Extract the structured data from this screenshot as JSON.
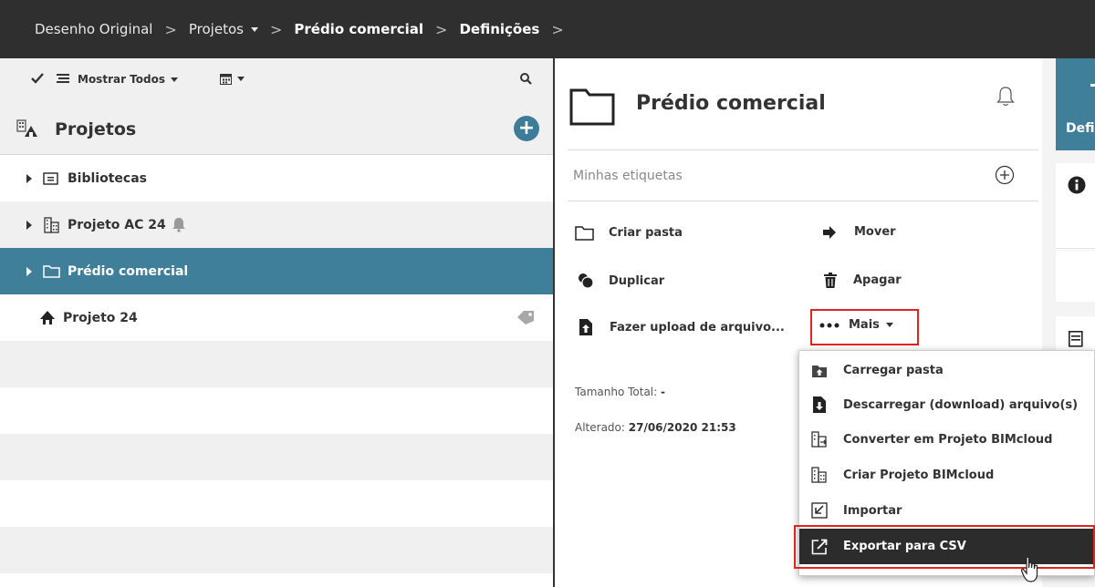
{
  "breadcrumb": {
    "items": [
      "Desenho Original",
      "Projetos",
      "Prédio comercial",
      "Definições"
    ]
  },
  "left_toolbar": {
    "filter_label": "Mostrar Todos"
  },
  "projects": {
    "title": "Projetos",
    "rows": [
      {
        "label": "Bibliotecas"
      },
      {
        "label": "Projeto AC 24"
      },
      {
        "label": "Prédio comercial"
      },
      {
        "label": "Projeto 24"
      }
    ]
  },
  "details": {
    "title": "Prédio comercial",
    "tags_placeholder": "Minhas etiquetas",
    "actions": {
      "create_folder": "Criar pasta",
      "move": "Mover",
      "duplicate": "Duplicar",
      "delete": "Apagar",
      "upload": "Fazer upload de arquivo...",
      "more": "Mais"
    },
    "total_size_label": "Tamanho Total:",
    "total_size_value": "-",
    "modified_label": "Alterado:",
    "modified_value": "27/06/2020 21:53"
  },
  "right_panel": {
    "tab_label": "Defi"
  },
  "more_menu": {
    "items": [
      "Carregar pasta",
      "Descarregar (download) arquivo(s)",
      "Converter em Projeto BIMcloud",
      "Criar Projeto BIMcloud",
      "Importar",
      "Exportar para CSV"
    ]
  },
  "colors": {
    "accent": "#3f7f9a",
    "topbar": "#2f2f2f",
    "highlight_border": "#e0241f"
  }
}
